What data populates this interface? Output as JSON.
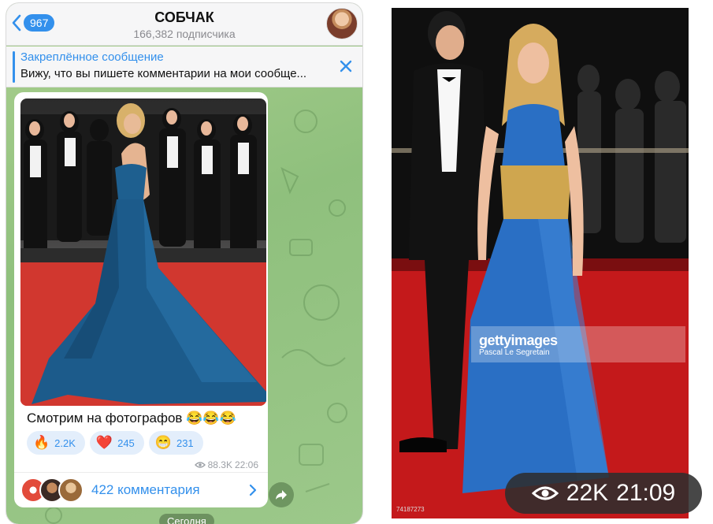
{
  "chat": {
    "back_badge": "967",
    "title": "СОБЧАК",
    "subscribers": "166,382 подписчика"
  },
  "pinned": {
    "title": "Закреплённое сообщение",
    "text": "Вижу, что вы пишете комментарии на мои сообще..."
  },
  "post": {
    "caption": "Смотрим на фотографов 😂😂😂",
    "reactions": [
      {
        "emoji": "🔥",
        "count": "2.2K"
      },
      {
        "emoji": "❤️",
        "count": "245"
      },
      {
        "emoji": "😁",
        "count": "231"
      }
    ],
    "views": "88.3K",
    "time": "22:06",
    "comments": "422 комментария"
  },
  "date_divider": "Сегодня",
  "right_photo": {
    "getty_logo": "gettyimages",
    "credit": "Pascal Le Segretain",
    "photo_id": "74187273",
    "views": "22K",
    "time": "21:09"
  },
  "colors": {
    "accent": "#3390ec",
    "chat_bg": "#9cc88a",
    "carpet": "#c3191b",
    "dress_left": "#1f5c8c",
    "dress_right": "#2a6fc4"
  },
  "icons": [
    "chevron-left-icon",
    "close-icon",
    "eye-icon",
    "chevron-right-icon",
    "share-icon"
  ]
}
